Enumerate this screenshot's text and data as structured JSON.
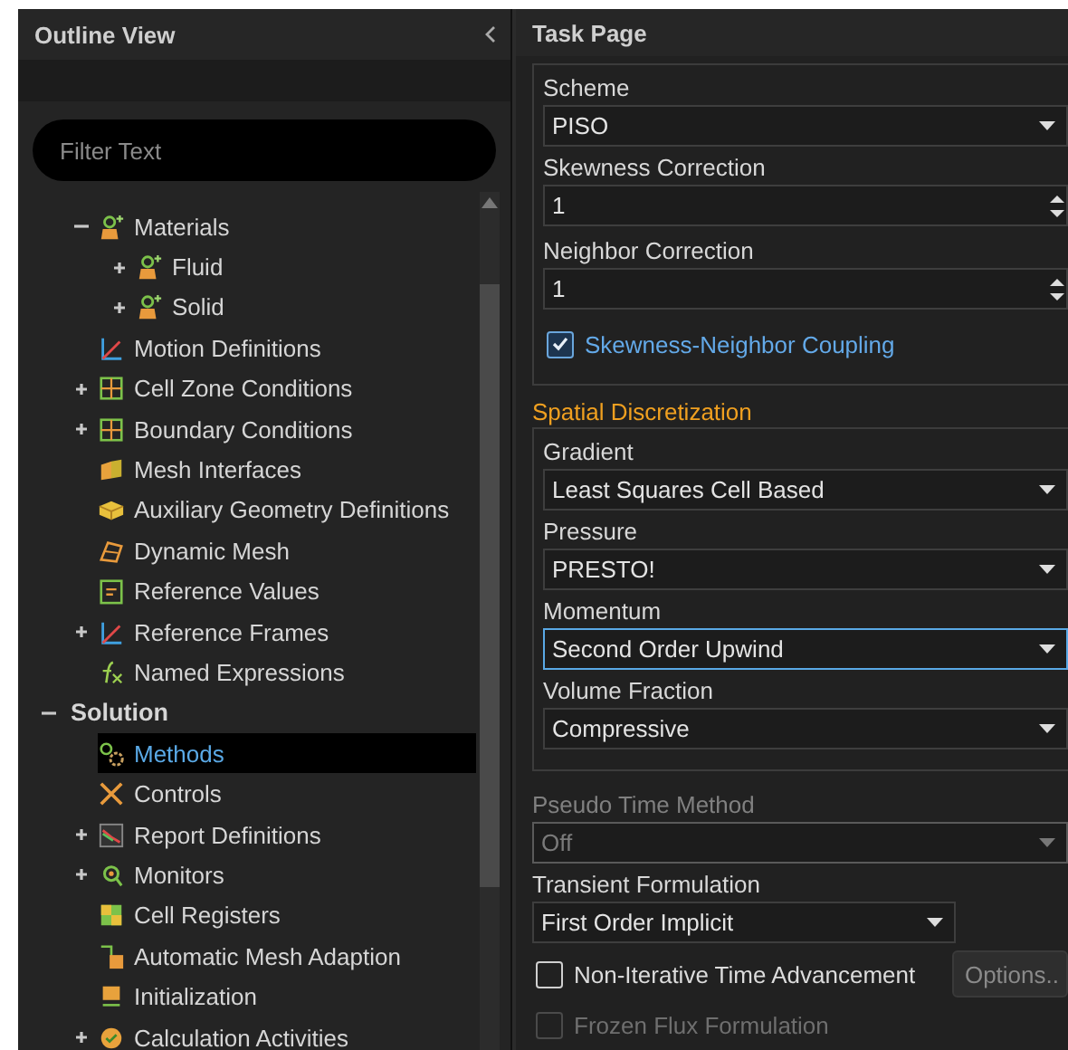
{
  "outline": {
    "title": "Outline View",
    "filter": {
      "placeholder": "Filter Text"
    },
    "tree": [
      {
        "children": [
          {
            "label": "Materials",
            "expanded": true,
            "selected": false,
            "children": [
              {
                "label": "Fluid",
                "expanded": false,
                "selected": false
              },
              {
                "label": "Solid",
                "expanded": false,
                "selected": false
              }
            ]
          },
          {
            "label": "Motion Definitions",
            "selected": false
          },
          {
            "label": "Cell Zone Conditions",
            "expanded": false,
            "selected": false
          },
          {
            "label": "Boundary Conditions",
            "expanded": false,
            "selected": false
          },
          {
            "label": "Mesh Interfaces",
            "selected": false
          },
          {
            "label": "Auxiliary Geometry Definitions",
            "selected": false
          },
          {
            "label": "Dynamic Mesh",
            "selected": false
          },
          {
            "label": "Reference Values",
            "selected": false
          },
          {
            "label": "Reference Frames",
            "expanded": false,
            "selected": false
          },
          {
            "label": "Named Expressions",
            "selected": false
          }
        ]
      },
      {
        "label": "Solution",
        "expanded": true,
        "selected": false,
        "children": [
          {
            "label": "Methods",
            "selected": true
          },
          {
            "label": "Controls",
            "selected": false
          },
          {
            "label": "Report Definitions",
            "expanded": false,
            "selected": false
          },
          {
            "label": "Monitors",
            "expanded": false,
            "selected": false
          },
          {
            "label": "Cell Registers",
            "selected": false
          },
          {
            "label": "Automatic Mesh Adaption",
            "selected": false
          },
          {
            "label": "Initialization",
            "selected": false
          },
          {
            "label": "Calculation Activities",
            "expanded": false,
            "selected": false
          }
        ]
      }
    ]
  },
  "task_page": {
    "title": "Task Page",
    "sections": [
      {
        "boxed": true,
        "items": [
          {
            "kind": "dropdown",
            "label": "Scheme",
            "value": "PISO",
            "focused": false,
            "disabled": false
          },
          {
            "kind": "spinner",
            "label": "Skewness Correction",
            "value": "1",
            "disabled": false
          },
          {
            "kind": "spinner",
            "label": "Neighbor Correction",
            "value": "1",
            "disabled": false
          },
          {
            "kind": "checkbox",
            "label": "Skewness-Neighbor Coupling",
            "checked": true,
            "highlighted": true,
            "disabled": false
          }
        ]
      },
      {
        "heading": "Spatial Discretization",
        "boxed": true,
        "items": [
          {
            "kind": "dropdown",
            "label": "Gradient",
            "value": "Least Squares Cell Based",
            "focused": false,
            "disabled": false
          },
          {
            "kind": "dropdown",
            "label": "Pressure",
            "value": "PRESTO!",
            "focused": false,
            "disabled": false
          },
          {
            "kind": "dropdown",
            "label": "Momentum",
            "value": "Second Order Upwind",
            "focused": true,
            "disabled": false
          },
          {
            "kind": "dropdown",
            "label": "Volume Fraction",
            "value": "Compressive",
            "focused": false,
            "disabled": false
          }
        ]
      },
      {
        "boxed": false,
        "items": [
          {
            "kind": "dropdown",
            "label": "Pseudo Time Method",
            "value": "Off",
            "focused": false,
            "disabled": true
          },
          {
            "kind": "dropdown",
            "label": "Transient Formulation",
            "value": "First Order Implicit",
            "focused": false,
            "disabled": false,
            "compact": true
          },
          {
            "kind": "checkbox",
            "label": "Non-Iterative Time Advancement",
            "checked": false,
            "highlighted": false,
            "disabled": false,
            "button": "Options.."
          },
          {
            "kind": "checkbox",
            "label": "Frozen Flux Formulation",
            "checked": false,
            "highlighted": false,
            "disabled": true
          }
        ]
      }
    ]
  }
}
